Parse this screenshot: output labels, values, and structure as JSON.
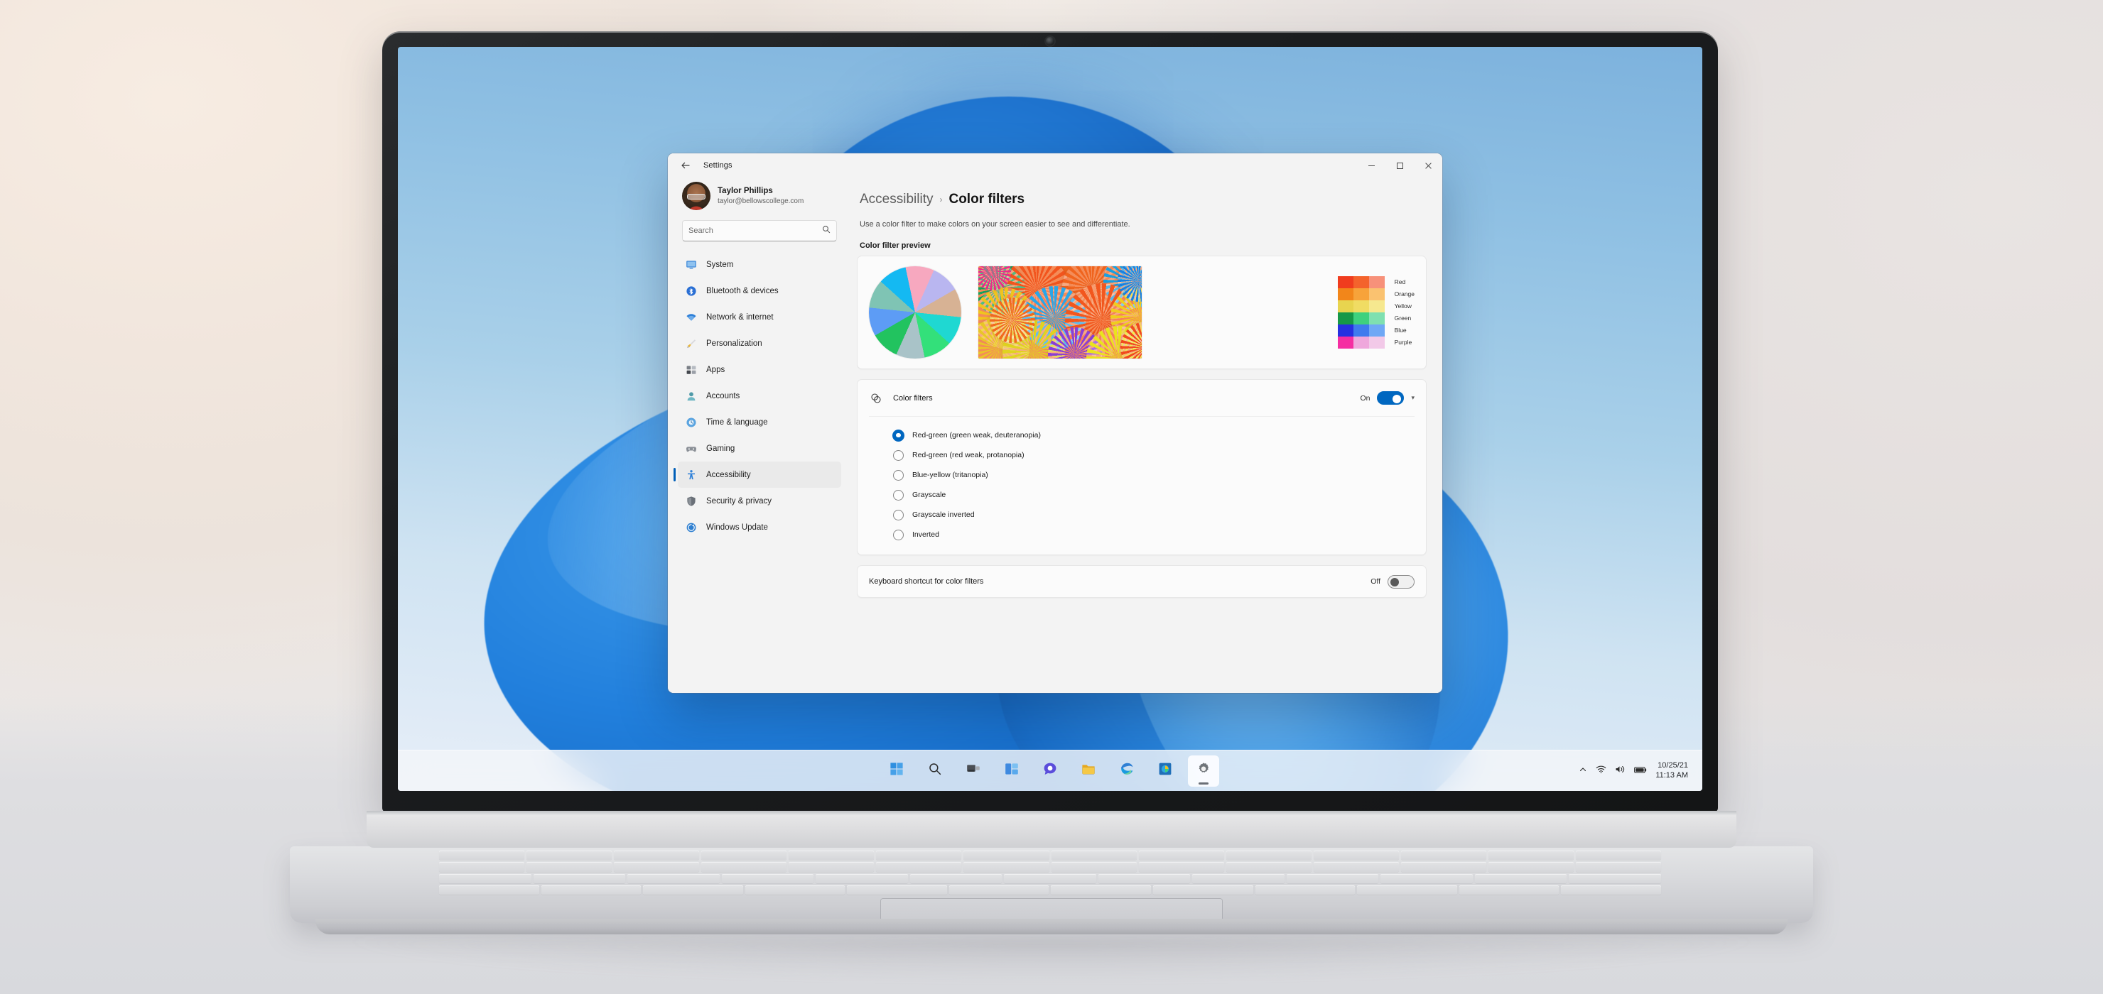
{
  "desktop": {
    "wallpaper_name": "windows-11-bloom-wallpaper",
    "taskbar": {
      "buttons": [
        {
          "name": "start-button",
          "icon": "windows-start-icon",
          "label": "Start",
          "active": false
        },
        {
          "name": "search-button",
          "icon": "search-icon",
          "label": "Search",
          "active": false
        },
        {
          "name": "task-view-button",
          "icon": "task-view-icon",
          "label": "Task view",
          "active": false
        },
        {
          "name": "widgets-button",
          "icon": "widgets-icon",
          "label": "Widgets",
          "active": false
        },
        {
          "name": "chat-button",
          "icon": "chat-teams-icon",
          "label": "Chat",
          "active": false
        },
        {
          "name": "file-explorer-button",
          "icon": "folder-icon",
          "label": "File Explorer",
          "active": false
        },
        {
          "name": "edge-button",
          "icon": "edge-browser-icon",
          "label": "Microsoft Edge",
          "active": false
        },
        {
          "name": "photos-button",
          "icon": "photos-icon",
          "label": "Photos",
          "active": false
        },
        {
          "name": "settings-button",
          "icon": "gear-icon",
          "label": "Settings",
          "active": true
        }
      ],
      "tray": {
        "overflow_icon": "chevron-up-icon",
        "network_icon": "wifi-icon",
        "volume_icon": "speaker-icon",
        "battery_icon": "battery-icon",
        "time": "11:13 AM",
        "date": "10/25/21"
      }
    }
  },
  "window": {
    "title": "Settings",
    "back_icon": "back-arrow-icon",
    "captions": {
      "minimize": "minimize-icon",
      "maximize": "maximize-icon",
      "close": "close-icon"
    }
  },
  "sidebar": {
    "account": {
      "name": "Taylor Phillips",
      "email": "taylor@bellowscollege.com",
      "avatar_name": "user-avatar"
    },
    "search": {
      "value": "",
      "placeholder": "Search",
      "icon": "search-icon"
    },
    "items": [
      {
        "label": "System",
        "icon": "monitor-icon",
        "selected": false
      },
      {
        "label": "Bluetooth & devices",
        "icon": "bluetooth-icon",
        "selected": false
      },
      {
        "label": "Network & internet",
        "icon": "wifi-icon",
        "selected": false
      },
      {
        "label": "Personalization",
        "icon": "paintbrush-icon",
        "selected": false
      },
      {
        "label": "Apps",
        "icon": "apps-grid-icon",
        "selected": false
      },
      {
        "label": "Accounts",
        "icon": "person-icon",
        "selected": false
      },
      {
        "label": "Time & language",
        "icon": "clock-globe-icon",
        "selected": false
      },
      {
        "label": "Gaming",
        "icon": "gamepad-icon",
        "selected": false
      },
      {
        "label": "Accessibility",
        "icon": "accessibility-person-icon",
        "selected": true
      },
      {
        "label": "Security & privacy",
        "icon": "shield-icon",
        "selected": false
      },
      {
        "label": "Windows Update",
        "icon": "windows-update-icon",
        "selected": false
      }
    ]
  },
  "page": {
    "breadcrumb_parent": "Accessibility",
    "breadcrumb_separator": "›",
    "breadcrumb_current": "Color filters",
    "description": "Use a color filter to make colors on your screen easier to see and differentiate.",
    "preview_heading": "Color filter preview",
    "preview": {
      "pie_name": "color-wheel-pie-preview",
      "photo_name": "colorful-umbrellas-photo-preview",
      "swatch_rows": [
        {
          "label": "Red",
          "shades": [
            "#f03c1e",
            "#f4632c",
            "#f7917a"
          ]
        },
        {
          "label": "Orange",
          "shades": [
            "#f2861a",
            "#f7a33a",
            "#fac270"
          ]
        },
        {
          "label": "Yellow",
          "shades": [
            "#e8d44f",
            "#f0dc63",
            "#f6e88f"
          ]
        },
        {
          "label": "Green",
          "shades": [
            "#179848",
            "#3fd17e",
            "#7fe0b0"
          ]
        },
        {
          "label": "Blue",
          "shades": [
            "#2730e0",
            "#3f7bee",
            "#6fa8f5"
          ]
        },
        {
          "label": "Purple",
          "shades": [
            "#f52ea2",
            "#efa7dc",
            "#f2c9e8"
          ]
        }
      ]
    },
    "color_filters": {
      "icon": "color-filter-icon",
      "label": "Color filters",
      "state_label": "On",
      "enabled": true,
      "expand_icon": "chevron-down-icon",
      "options": [
        {
          "label": "Red-green (green weak, deuteranopia)",
          "selected": true
        },
        {
          "label": "Red-green (red weak, protanopia)",
          "selected": false
        },
        {
          "label": "Blue-yellow (tritanopia)",
          "selected": false
        },
        {
          "label": "Grayscale",
          "selected": false
        },
        {
          "label": "Grayscale inverted",
          "selected": false
        },
        {
          "label": "Inverted",
          "selected": false
        }
      ]
    },
    "keyboard_shortcut": {
      "label": "Keyboard shortcut for color filters",
      "state_label": "Off",
      "enabled": false
    }
  },
  "theme": {
    "accent": "#0067c0",
    "accent_bar": "#005fb8",
    "window_bg": "#f3f3f3",
    "card_bg": "#fbfbfb",
    "text": "#1a1a1a",
    "muted_text": "#5d5d5d"
  }
}
